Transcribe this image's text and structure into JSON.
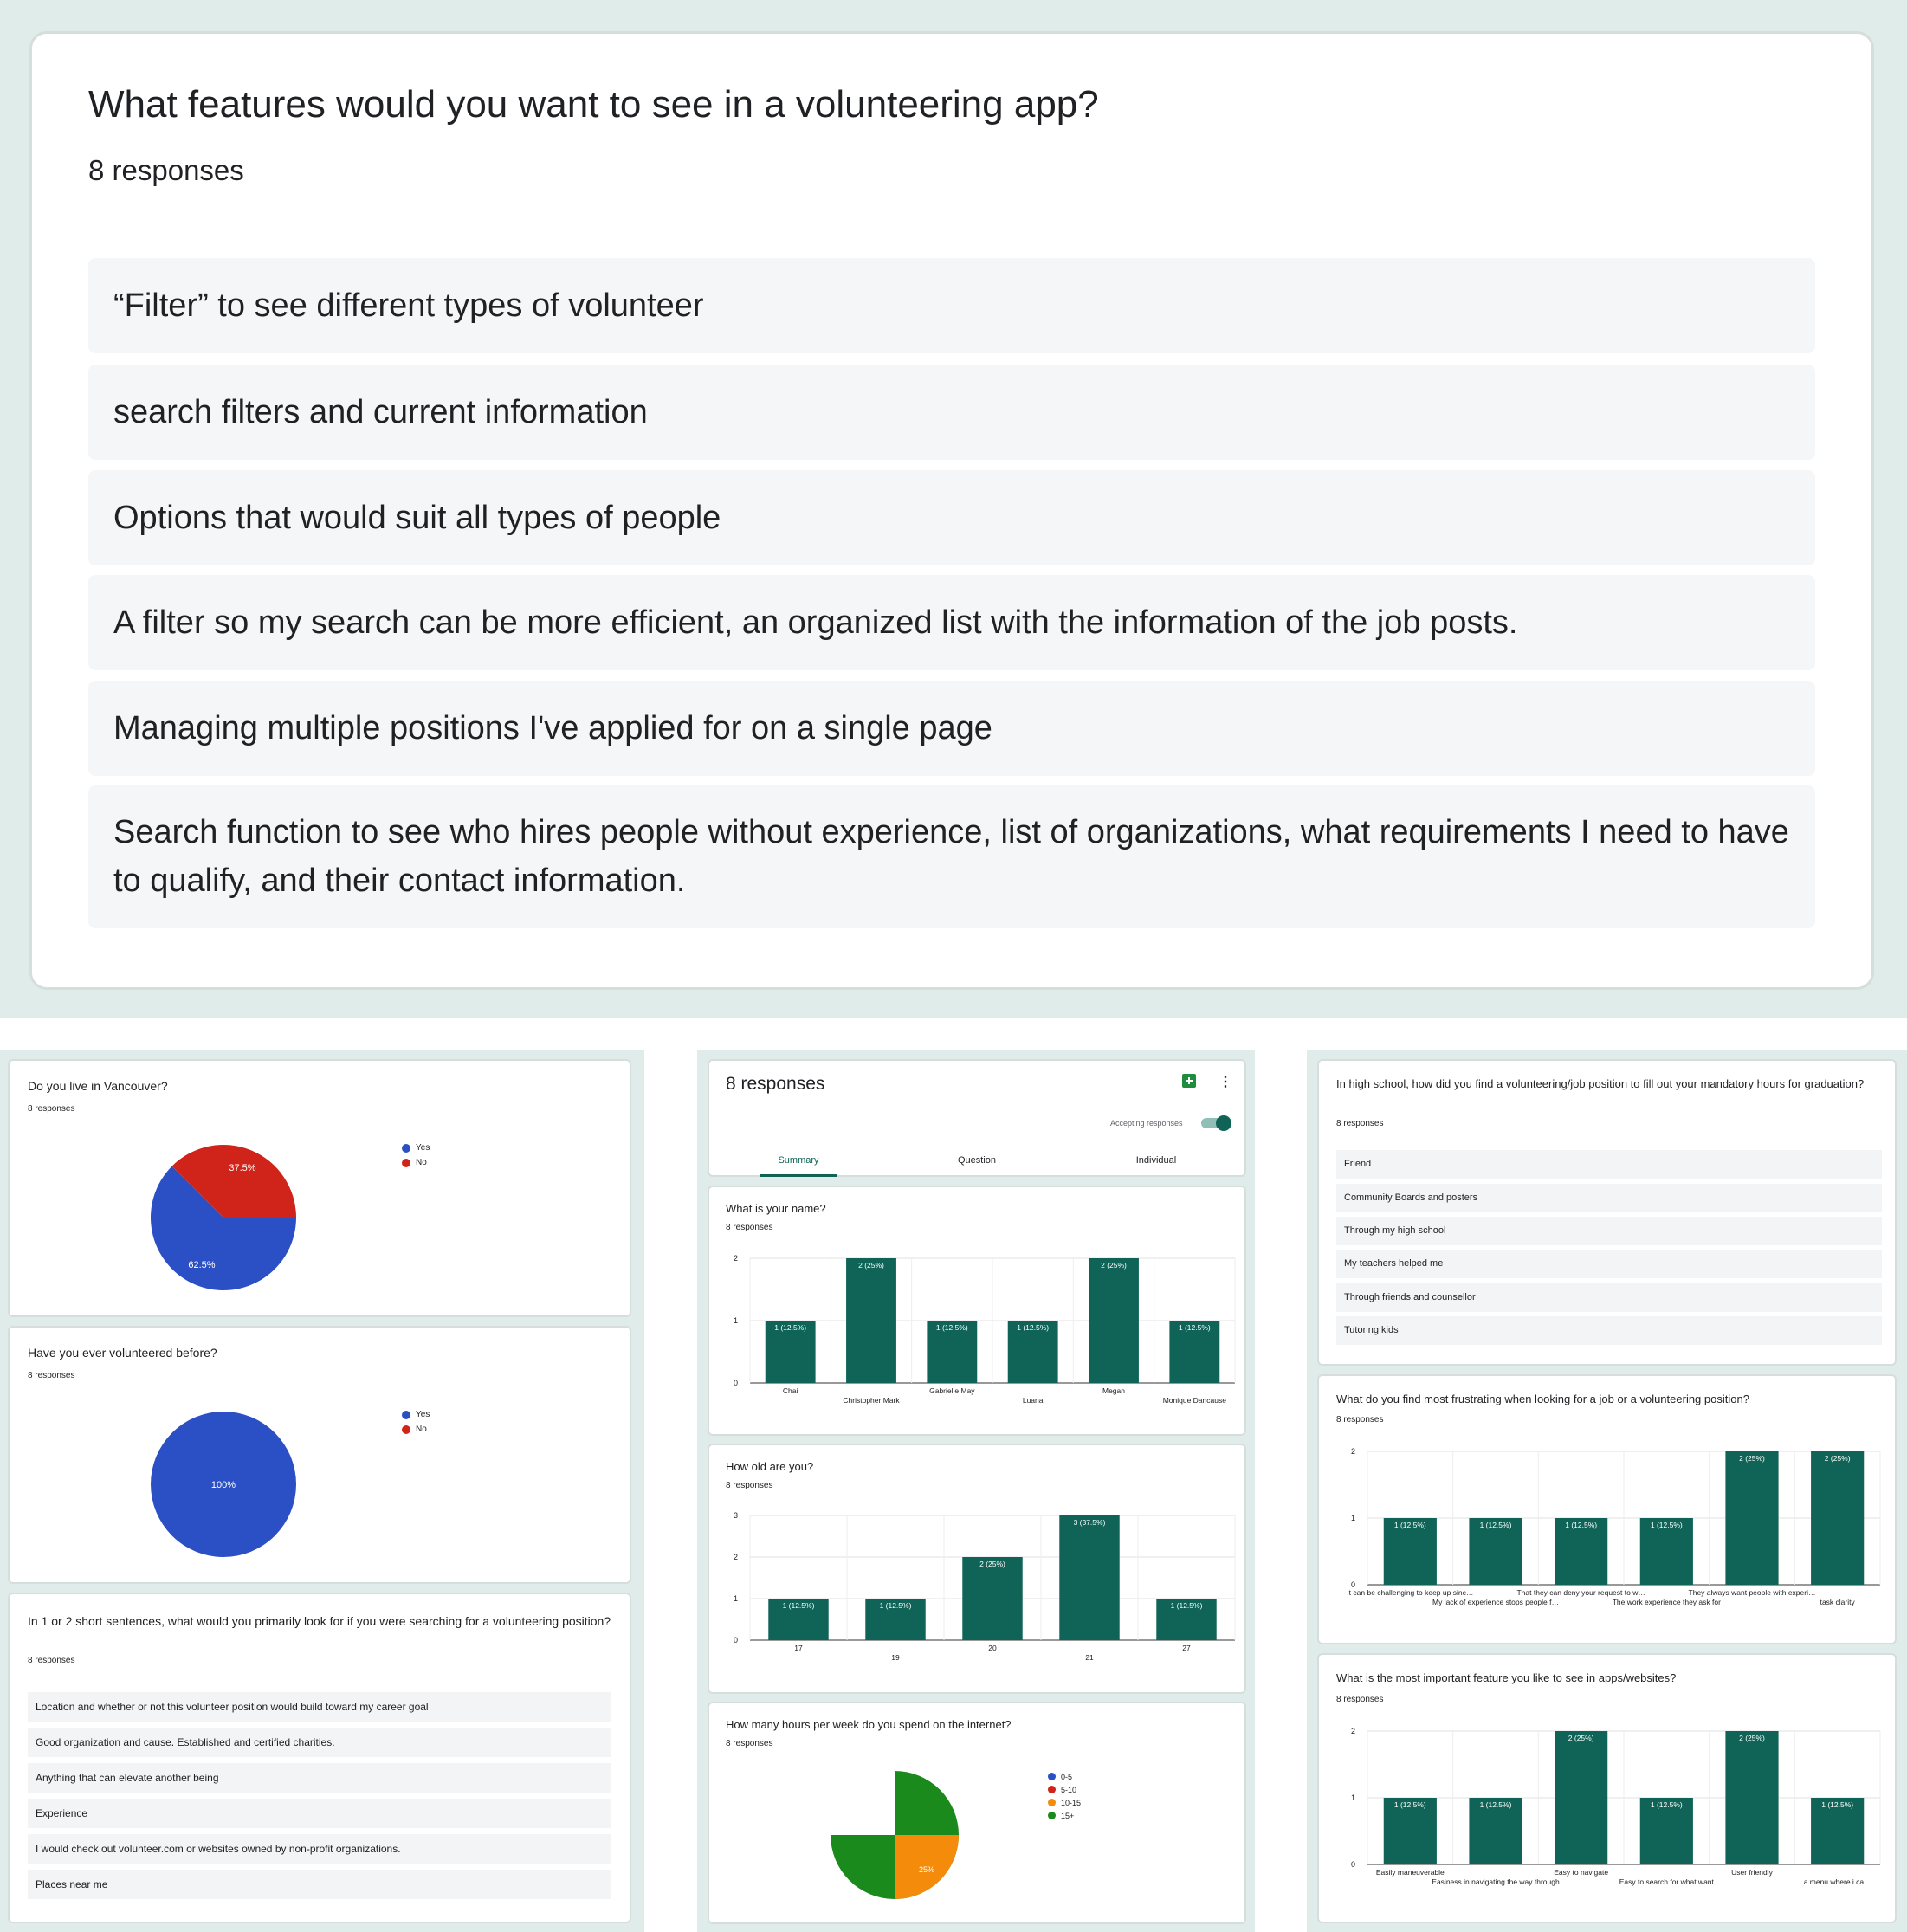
{
  "top": {
    "title": "What features would you want to see in a volunteering app?",
    "count": "8 responses",
    "responses": [
      "“Filter” to see different types of volunteer",
      "search filters and current information",
      "Options that would suit all types of people",
      "A filter so my search can be more efficient, an organized list with the information of the job posts.",
      "Managing multiple positions I've applied for on a single page",
      "Search function to see who hires people without experience, list of organizations, what requirements I need to have to qualify, and their contact information."
    ]
  },
  "left": {
    "vancouver": {
      "title": "Do you live in Vancouver?",
      "count": "8 responses",
      "legend": [
        "Yes",
        "No"
      ],
      "slice_labels": [
        "62.5%",
        "37.5%"
      ]
    },
    "volunteered": {
      "title": "Have you ever volunteered before?",
      "count": "8 responses",
      "legend": [
        "Yes",
        "No"
      ],
      "slice_labels": [
        "100%"
      ]
    },
    "short": {
      "title": "In 1 or 2 short sentences, what would you primarily look for if you were searching for a volunteering position?",
      "count": "8 responses",
      "responses": [
        "Location and whether or not this volunteer position would build toward my career goal",
        "Good organization and cause. Established and certified charities.",
        "Anything that can elevate another being",
        "Experience",
        "I would check out volunteer.com or websites owned by non-profit organizations.",
        "Places near me"
      ]
    }
  },
  "middle": {
    "header": {
      "title": "8 responses",
      "accepting": "Accepting responses",
      "tabs": [
        "Summary",
        "Question",
        "Individual"
      ]
    },
    "name": {
      "title": "What is your name?",
      "count": "8 responses"
    },
    "age": {
      "title": "How old are you?",
      "count": "8 responses"
    },
    "hours": {
      "title": "How many hours per week do you spend on the internet?",
      "count": "8 responses",
      "legend": [
        "0-5",
        "5-10",
        "10-15",
        "15+"
      ],
      "slice_labels": [
        "75%",
        "25%"
      ]
    }
  },
  "right": {
    "highschool": {
      "title": "In high school, how did you find a volunteering/job position to fill out your mandatory hours for graduation?",
      "count": "8 responses",
      "responses": [
        "Friend",
        "Community Boards and posters",
        "Through my high school",
        "My teachers helped me",
        "Through friends and counsellor",
        "Tutoring kids"
      ]
    },
    "frustrating": {
      "title": "What do you find most frustrating when looking for a job or a volunteering position?",
      "count": "8 responses"
    },
    "feature": {
      "title": "What is the most important feature you like to see in apps/websites?",
      "count": "8 responses"
    }
  },
  "colors": {
    "bar": "#0f6457",
    "blue": "#2b4fc4",
    "red": "#d0241a",
    "orange": "#f48b0b",
    "green": "#1b8a1d",
    "bg": "#dfece9"
  },
  "chart_data": [
    {
      "type": "pie",
      "title": "Do you live in Vancouver?",
      "categories": [
        "Yes",
        "No"
      ],
      "values": [
        62.5,
        37.5
      ]
    },
    {
      "type": "pie",
      "title": "Have you ever volunteered before?",
      "categories": [
        "Yes",
        "No"
      ],
      "values": [
        100,
        0
      ]
    },
    {
      "type": "bar",
      "title": "What is your name?",
      "categories": [
        "Chai",
        "Christopher Mark",
        "Gabrielle May",
        "Luana",
        "Megan",
        "Monique Dancause"
      ],
      "values": [
        1,
        2,
        1,
        1,
        2,
        1
      ],
      "data_labels": [
        "1 (12.5%)",
        "2 (25%)",
        "1 (12.5%)",
        "1 (12.5%)",
        "2 (25%)",
        "1 (12.5%)"
      ],
      "yticks": [
        "0",
        "1",
        "2"
      ],
      "ylim": [
        0,
        2
      ]
    },
    {
      "type": "bar",
      "title": "How old are you?",
      "categories": [
        "17",
        "19",
        "20",
        "21",
        "27"
      ],
      "values": [
        1,
        1,
        2,
        3,
        1
      ],
      "data_labels": [
        "1 (12.5%)",
        "1 (12.5%)",
        "2 (25%)",
        "3 (37.5%)",
        "1 (12.5%)"
      ],
      "yticks": [
        "0",
        "1",
        "2",
        "3"
      ],
      "ylim": [
        0,
        3
      ]
    },
    {
      "type": "pie",
      "title": "How many hours per week do you spend on the internet?",
      "categories": [
        "0-5",
        "5-10",
        "10-15",
        "15+"
      ],
      "values": [
        0,
        0,
        25,
        75
      ]
    },
    {
      "type": "bar",
      "title": "What do you find most frustrating when looking for a job or a volunteering position?",
      "categories": [
        "It can be challenging to keep up sinc…",
        "My lack of experience stops people f…",
        "That they can deny your request to w…",
        "The work experience they ask for",
        "They always want people with experi…",
        "task clarity"
      ],
      "values": [
        1,
        1,
        1,
        1,
        2,
        2
      ],
      "data_labels": [
        "1 (12.5%)",
        "1 (12.5%)",
        "1 (12.5%)",
        "1 (12.5%)",
        "2 (25%)",
        "2 (25%)"
      ],
      "yticks": [
        "0",
        "1",
        "2"
      ],
      "ylim": [
        0,
        2
      ]
    },
    {
      "type": "bar",
      "title": "What is the most important feature you like to see in apps/websites?",
      "categories": [
        "Easily maneuverable",
        "Easiness in navigating the way through",
        "Easy to navigate",
        "Easy to search for what want",
        "User friendly",
        "a menu where i ca…"
      ],
      "values": [
        1,
        1,
        2,
        1,
        2,
        1
      ],
      "data_labels": [
        "1 (12.5%)",
        "1 (12.5%)",
        "2 (25%)",
        "1 (12.5%)",
        "2 (25%)",
        "1 (12.5%)"
      ],
      "yticks": [
        "0",
        "1",
        "2"
      ],
      "ylim": [
        0,
        2
      ]
    }
  ]
}
